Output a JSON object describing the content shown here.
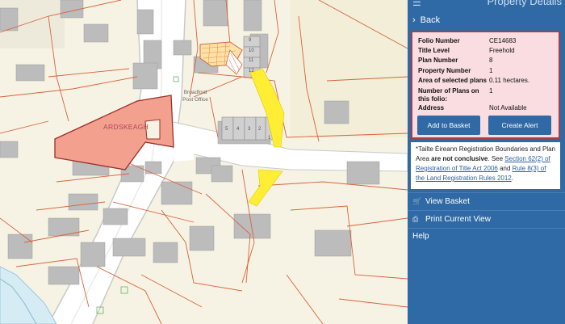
{
  "panel": {
    "title": "Property Details",
    "back_label": "Back",
    "fields": [
      {
        "key": "Folio Number",
        "value": "CE14683"
      },
      {
        "key": "Title Level",
        "value": "Freehold"
      },
      {
        "key": "Plan Number",
        "value": "8"
      },
      {
        "key": "Property Number",
        "value": "1"
      },
      {
        "key": "Area of selected plans",
        "value": "0.11 hectares."
      },
      {
        "key": "Number of Plans on this folio:",
        "value": "1"
      },
      {
        "key": "Address",
        "value": "Not Available"
      }
    ],
    "add_to_basket": "Add to Basket",
    "create_alert": "Create Alert",
    "note": {
      "part1": "*Tailte Éireann Registration Boundaries and Plan Area ",
      "bold": "are not conclusive",
      "part2": ". See ",
      "link1": "Section 62(2) of Registration of Title Act 2006",
      "part3": " and ",
      "link2": "Rule 8(3) of the Land Registration Rules 2012",
      "part4": "."
    },
    "menu": [
      {
        "label": "View Basket",
        "icon": "cart-icon"
      },
      {
        "label": "Print Current View",
        "icon": "print-icon"
      },
      {
        "label": "Help",
        "icon": ""
      }
    ]
  },
  "map": {
    "labels": {
      "ardskeagh": "ARDSKEAGH",
      "post_office": "Broadford Post Office"
    },
    "house_numbers": [
      "5",
      "4",
      "3",
      "2",
      "1",
      "9",
      "10",
      "11",
      "12"
    ]
  },
  "colors": {
    "panel": "#2f6aa6",
    "info_box": "#fadde0",
    "info_border": "#a64046",
    "parcel_fill": "#f3a08f",
    "highlight": "#ffee33",
    "boundary": "#d9633c"
  }
}
